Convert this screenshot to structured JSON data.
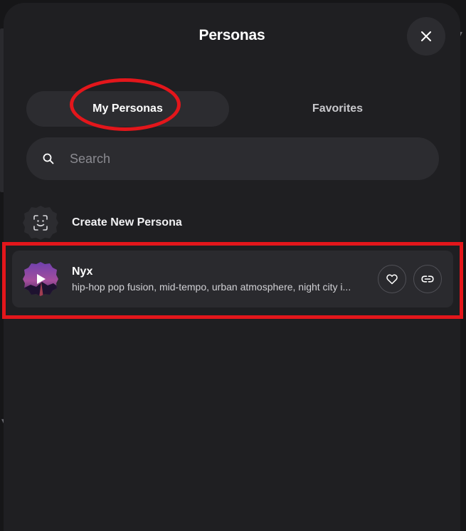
{
  "modal": {
    "title": "Personas",
    "close_icon": "close-icon"
  },
  "tabs": [
    {
      "label": "My Personas",
      "active": true
    },
    {
      "label": "Favorites",
      "active": false
    }
  ],
  "search": {
    "placeholder": "Search",
    "value": "",
    "icon": "search-icon"
  },
  "create": {
    "label": "Create New Persona",
    "icon": "face-scan-icon"
  },
  "personas": [
    {
      "name": "Nyx",
      "description": "hip-hop pop fusion, mid-tempo, urban atmosphere, night city i...",
      "avatar_icon": "play-icon",
      "actions": [
        "heart-icon",
        "link-icon"
      ]
    }
  ],
  "colors": {
    "modal_bg": "#1f1f22",
    "control_bg": "#2c2c30",
    "row_bg": "#2a2a2e",
    "annotation": "#e3161b"
  }
}
